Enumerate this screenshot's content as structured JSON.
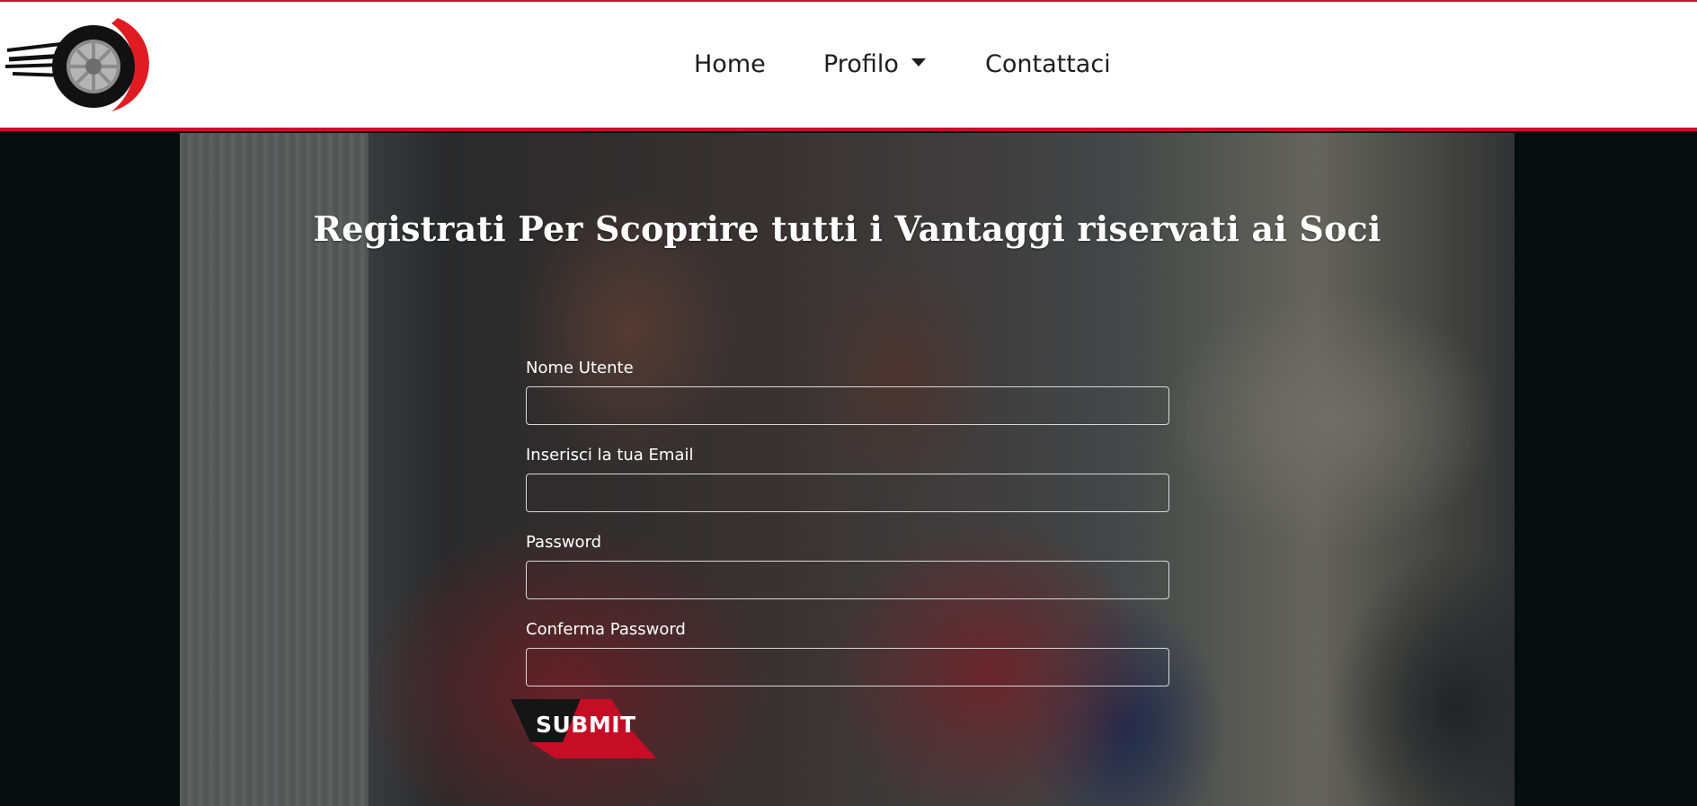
{
  "nav": {
    "home": "Home",
    "profilo": "Profilo",
    "contattaci": "Contattaci"
  },
  "hero": {
    "title": "Registrati Per Scoprire tutti i Vantaggi riservati ai Soci"
  },
  "form": {
    "username_label": "Nome Utente",
    "email_label": "Inserisci la tua Email",
    "password_label": "Password",
    "confirm_label": "Conferma Password",
    "submit_label": "SUBMIT"
  },
  "colors": {
    "accent": "#c8102e",
    "dark": "#050d0d"
  }
}
